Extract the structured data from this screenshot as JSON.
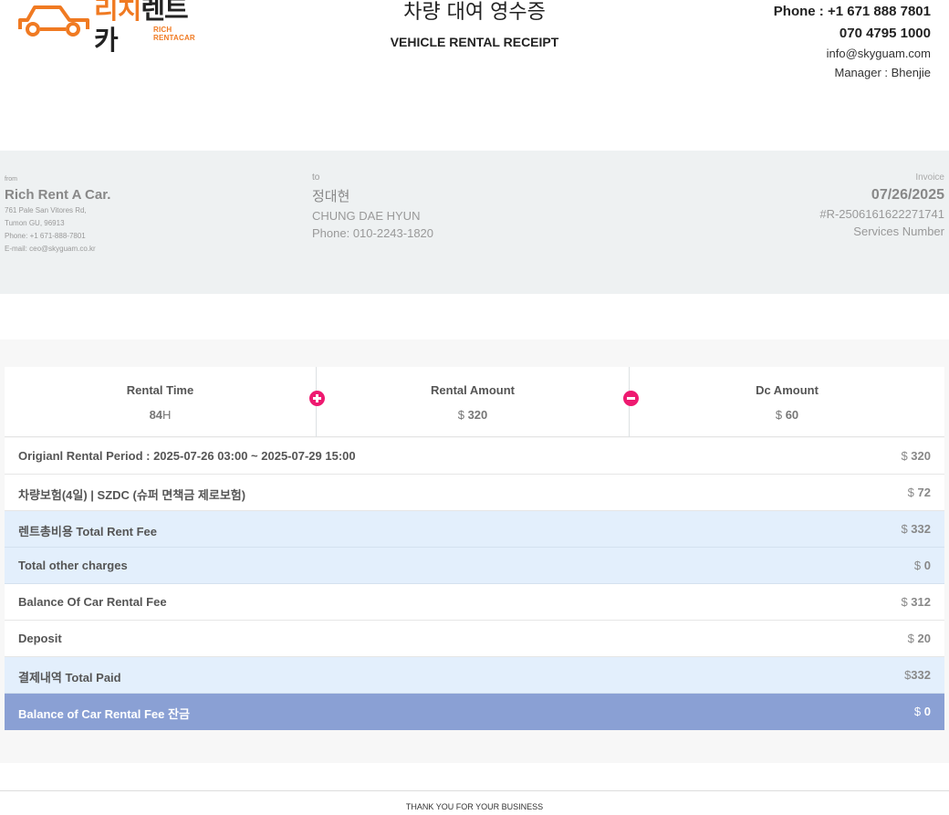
{
  "logo": {
    "brand_ko_orange": "리치",
    "brand_ko_dark": "렌트카",
    "brand_en": "RICH RENTACAR",
    "accent": "#f07a22"
  },
  "header": {
    "title_ko": "차량 대여 영수증",
    "title_en": "VEHICLE RENTAL RECEIPT"
  },
  "contact": {
    "phone": "Phone : +1 671 888 7801",
    "phone2": "070 4795 1000",
    "email": "info@skyguam.com",
    "manager": "Manager : Bhenjie"
  },
  "from": {
    "label": "from",
    "name": "Rich Rent A Car.",
    "address1": "761 Pale San Vitores Rd,",
    "address2": "Tumon GU, 96913",
    "phone": "Phone: +1 671-888-7801",
    "email": "E-mail: ceo@skyguam.co.kr"
  },
  "to": {
    "label": "to",
    "name_ko": "정대현",
    "name_en": "CHUNG DAE HYUN",
    "phone": "Phone: 010-2243-1820"
  },
  "invoice": {
    "label": "Invoice",
    "date": "07/26/2025",
    "number": "#R-2506161622271741",
    "services": "Services Number"
  },
  "summary": {
    "rental_time_label": "Rental Time",
    "rental_time_value": "84",
    "rental_time_unit": "H",
    "rental_amount_label": "Rental Amount",
    "rental_amount_currency": "$",
    "rental_amount_value": "320",
    "dc_amount_label": "Dc Amount",
    "dc_amount_currency": "$",
    "dc_amount_value": "60",
    "plus_color": "#ee1a70"
  },
  "rows": [
    {
      "label": "Origianl Rental Period : 2025-07-26 03:00 ~ 2025-07-29 15:00",
      "currency": "$",
      "value": "320"
    },
    {
      "label": "차량보험(4일) | SZDC (슈퍼 면책금 제로보험)",
      "currency": "$",
      "value": "72"
    },
    {
      "label": "렌트총비용 Total Rent Fee",
      "currency": "$",
      "value": "332"
    },
    {
      "label": "Total other charges",
      "currency": "$",
      "value": "0"
    },
    {
      "label": "Balance Of Car Rental Fee",
      "currency": "$",
      "value": "312"
    },
    {
      "label": "Deposit",
      "currency": "$",
      "value": "20"
    },
    {
      "label": "결제내역 Total Paid",
      "currency": "$",
      "value": "332"
    },
    {
      "label": "Balance of Car Rental Fee 잔금",
      "currency": "$",
      "value": "0"
    }
  ],
  "footer": {
    "thanks": "THANK YOU FOR YOUR BUSINESS"
  }
}
